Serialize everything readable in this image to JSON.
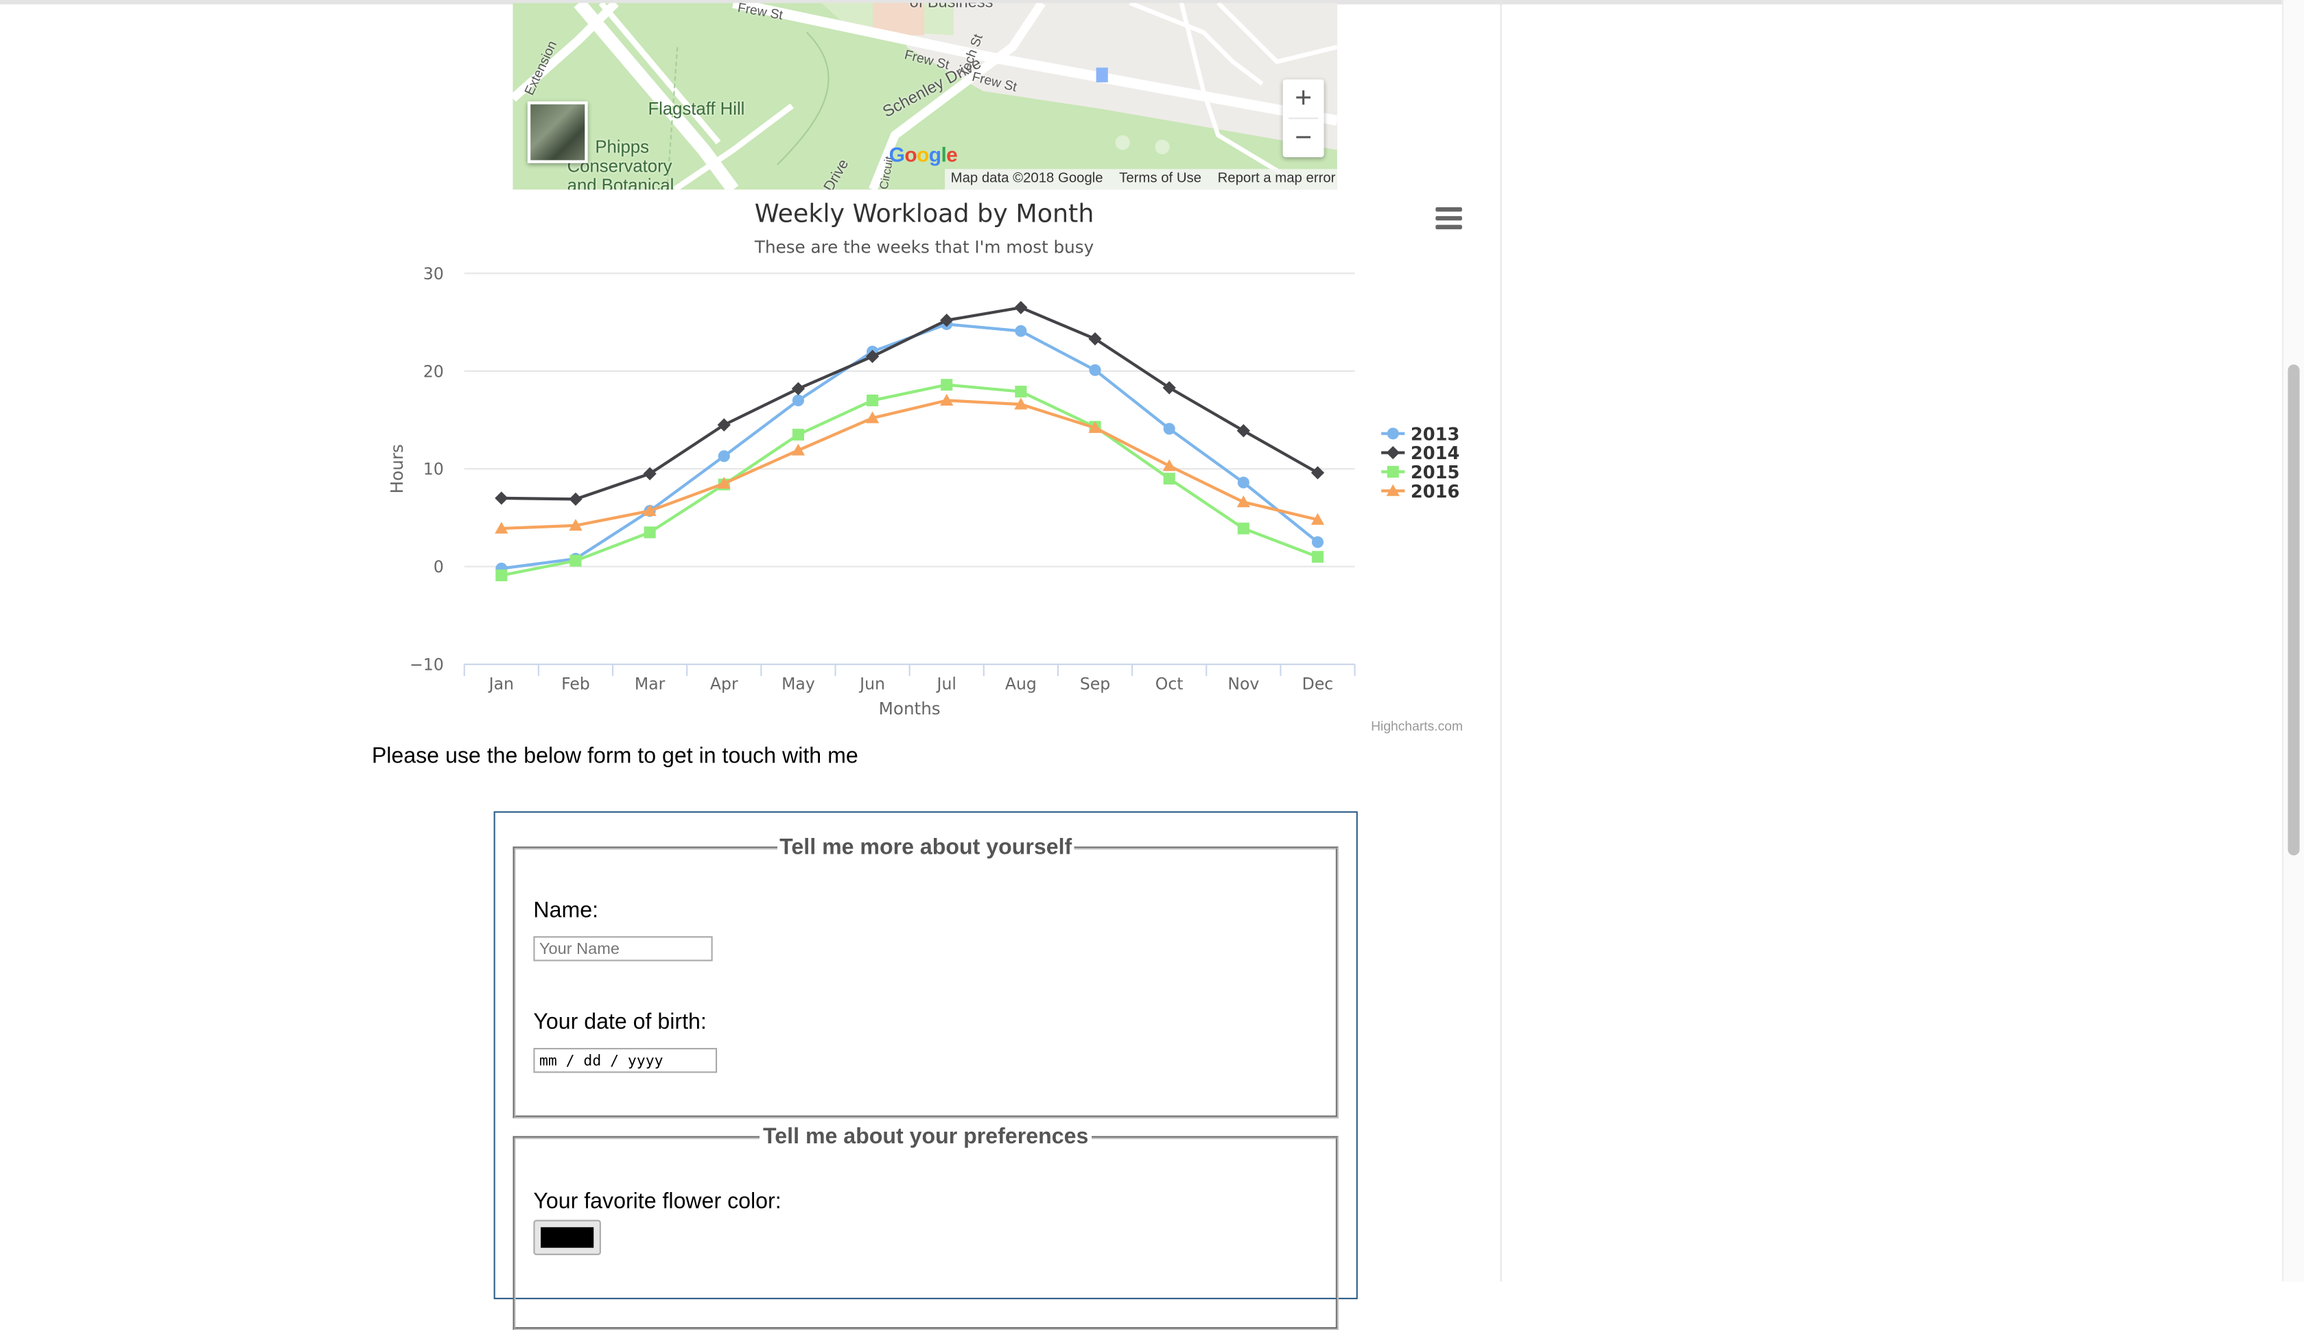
{
  "map": {
    "labels": {
      "flagstaff": "Flagstaff Hill",
      "phipps": "Phipps",
      "conservatory": "Conservatory",
      "botanical": "and Botanical",
      "schenley": "Schenley Drive",
      "frew1": "Frew St",
      "frew2": "Frew St",
      "frew_top": "Frew St",
      "tech": "Tech St",
      "business": "of Business",
      "extension": "Extension",
      "drive": "Drive",
      "circuit": "Circuit"
    },
    "zoom_in": "+",
    "zoom_out": "−",
    "google": [
      "G",
      "o",
      "o",
      "g",
      "l",
      "e"
    ],
    "google_colors": [
      "#4285f4",
      "#ea4335",
      "#fbbc05",
      "#4285f4",
      "#34a853",
      "#ea4335"
    ],
    "footer": {
      "data": "Map data ©2018 Google",
      "terms": "Terms of Use",
      "report": "Report a map error"
    }
  },
  "chart_data": {
    "type": "line",
    "title": "Weekly Workload by Month",
    "subtitle": "These are the weeks that I'm most busy",
    "xlabel": "Months",
    "ylabel": "Hours",
    "categories": [
      "Jan",
      "Feb",
      "Mar",
      "Apr",
      "May",
      "Jun",
      "Jul",
      "Aug",
      "Sep",
      "Oct",
      "Nov",
      "Dec"
    ],
    "ylim": [
      -10,
      30
    ],
    "yticks": [
      -10,
      0,
      10,
      20,
      30
    ],
    "grid": true,
    "legend_position": "right",
    "series": [
      {
        "name": "2013",
        "color": "#7cb5ec",
        "marker": "circle",
        "values": [
          -0.2,
          0.8,
          5.7,
          11.3,
          17.0,
          22.0,
          24.8,
          24.1,
          20.1,
          14.1,
          8.6,
          2.5
        ]
      },
      {
        "name": "2014",
        "color": "#434348",
        "marker": "diamond",
        "values": [
          7.0,
          6.9,
          9.5,
          14.5,
          18.2,
          21.5,
          25.2,
          26.5,
          23.3,
          18.3,
          13.9,
          9.6
        ]
      },
      {
        "name": "2015",
        "color": "#90ed7d",
        "marker": "square",
        "values": [
          -0.9,
          0.6,
          3.5,
          8.4,
          13.5,
          17.0,
          18.6,
          17.9,
          14.3,
          9.0,
          3.9,
          1.0
        ]
      },
      {
        "name": "2016",
        "color": "#f7a35c",
        "marker": "triangle",
        "values": [
          3.9,
          4.2,
          5.7,
          8.5,
          11.9,
          15.2,
          17.0,
          16.6,
          14.2,
          10.3,
          6.6,
          4.8
        ]
      }
    ]
  },
  "chart_credits": "Highcharts.com",
  "intro_text": "Please use the below form to get in touch with me",
  "form": {
    "about_legend": "Tell me more about yourself",
    "name_label": "Name:",
    "name_placeholder": "Your Name",
    "dob_label": "Your date of birth:",
    "dob_placeholder": "mm / dd / yyyy",
    "prefs_legend": "Tell me about your preferences",
    "flower_label": "Your favorite flower color:",
    "flower_color": "#000000"
  }
}
